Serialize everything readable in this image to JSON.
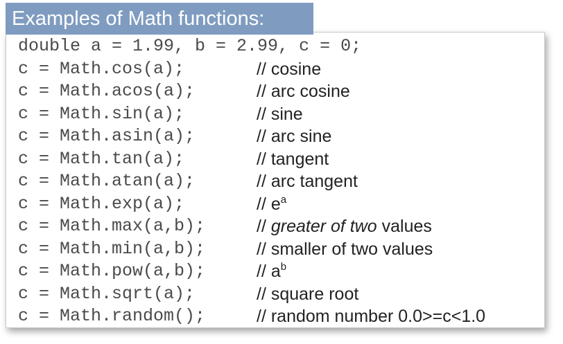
{
  "title": "Examples of Math functions:",
  "declaration": "double a = 1.99, b = 2.99, c = 0;",
  "lines": [
    {
      "code": "c = Math.cos(a);",
      "comment": "// cosine"
    },
    {
      "code": "c = Math.acos(a);",
      "comment": "// arc cosine"
    },
    {
      "code": "c = Math.sin(a);",
      "comment": "// sine"
    },
    {
      "code": "c = Math.asin(a);",
      "comment": "// arc sine"
    },
    {
      "code": "c = Math.tan(a);",
      "comment": "// tangent"
    },
    {
      "code": "c = Math.atan(a);",
      "comment": "// arc tangent"
    },
    {
      "code": "c = Math.exp(a);",
      "comment_prefix": "// e",
      "comment_sup": "a"
    },
    {
      "code": "c = Math.max(a,b);",
      "comment_prefix": "// ",
      "comment_italic": "greater of two",
      "comment_suffix": " values"
    },
    {
      "code": "c = Math.min(a,b);",
      "comment": "// smaller of two values"
    },
    {
      "code": "c = Math.pow(a,b);",
      "comment_prefix": "// a",
      "comment_sup": "b"
    },
    {
      "code": "c = Math.sqrt(a);",
      "comment": "// square root"
    },
    {
      "code": "c = Math.random();",
      "comment": "// random number 0.0>=c<1.0"
    }
  ]
}
